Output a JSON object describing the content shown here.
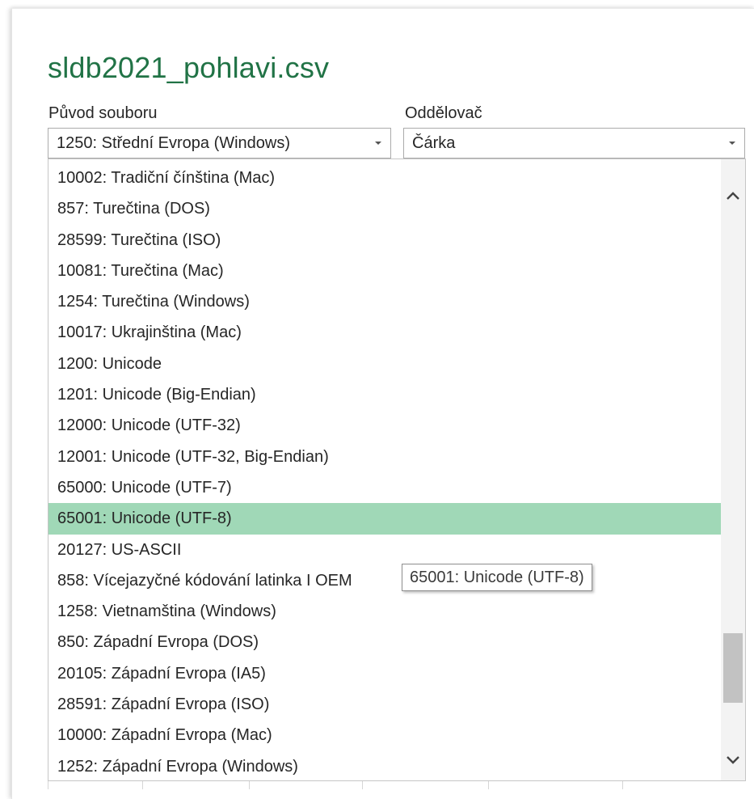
{
  "dialog": {
    "title": "sldb2021_pohlavi.csv"
  },
  "file_origin": {
    "label": "Původ souboru",
    "value": "1250: Střední Evropa (Windows)"
  },
  "delimiter": {
    "label": "Oddělovač",
    "value": "Čárka"
  },
  "encoding_list": {
    "options": [
      "10002: Tradiční čínština (Mac)",
      "857: Turečtina (DOS)",
      "28599: Turečtina (ISO)",
      "10081: Turečtina (Mac)",
      "1254: Turečtina (Windows)",
      "10017: Ukrajinština (Mac)",
      "1200: Unicode",
      "1201: Unicode (Big-Endian)",
      "12000: Unicode (UTF-32)",
      "12001: Unicode (UTF-32, Big-Endian)",
      "65000: Unicode (UTF-7)",
      "65001: Unicode (UTF-8)",
      "20127: US-ASCII",
      "858: Vícejazyčné kódování latinka I OEM",
      "1258: Vietnamština (Windows)",
      "850: Západní Evropa (DOS)",
      "20105: Západní Evropa (IA5)",
      "28591: Západní Evropa (ISO)",
      "10000: Západní Evropa (Mac)",
      "1252: Západní Evropa (Windows)"
    ],
    "highlighted": "65001: Unicode (UTF-8)",
    "tooltip": "65001: Unicode (UTF-8)"
  },
  "colors": {
    "title": "#217346",
    "highlight": "#a0d8b7",
    "scroll_thumb": "#c2c2c2"
  },
  "icons": {
    "select_arrow": "caret-down-icon",
    "scroll_up": "chevron-up-icon",
    "scroll_down": "chevron-down-icon"
  }
}
